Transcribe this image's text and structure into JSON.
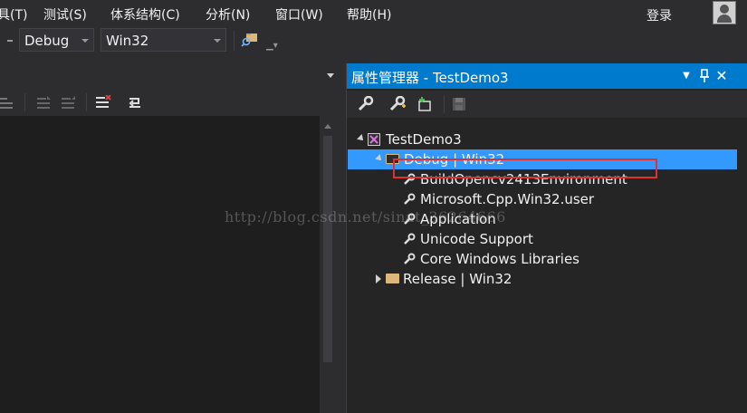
{
  "menu": {
    "items": [
      "具(T)",
      "测试(S)",
      "体系结构(C)",
      "分析(N)",
      "窗口(W)",
      "帮助(H)"
    ],
    "login": "登录"
  },
  "toolbar": {
    "configuration": "Debug",
    "platform": "Win32"
  },
  "property_manager": {
    "title": "属性管理器 - TestDemo3",
    "tree": {
      "project": "TestDemo3",
      "configs": [
        {
          "label": "Debug | Win32",
          "expanded": true,
          "selected": true,
          "sheets": [
            "BuildOpencv2413Environment",
            "Microsoft.Cpp.Win32.user",
            "Application",
            "Unicode Support",
            "Core Windows Libraries"
          ]
        },
        {
          "label": "Release | Win32",
          "expanded": false,
          "selected": false,
          "sheets": []
        }
      ]
    }
  },
  "watermark": "http://blog.csdn.net/sinat_36264666",
  "colors": {
    "accent": "#007acc",
    "selection": "#3399ff",
    "highlight_box": "#e03030",
    "folder": "#dcb67a"
  }
}
